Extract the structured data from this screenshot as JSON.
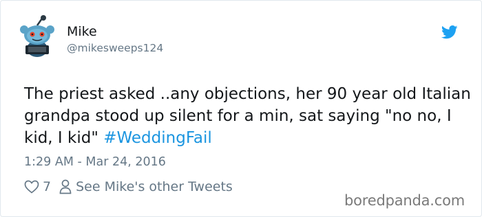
{
  "tweet": {
    "author_name": "Mike",
    "author_handle": "@mikesweeps124",
    "text": "The priest asked ..any objections, her 90 year old Italian grandpa stood up silent for a min, sat saying \"no no, I kid, I kid\" ",
    "hashtag": "#WeddingFail",
    "timestamp": "1:29 AM - Mar 24, 2016",
    "like_count": "7",
    "see_more_label": "See Mike's other Tweets"
  },
  "watermark": "boredpanda.com",
  "colors": {
    "twitter_blue": "#1da1f2",
    "hashtag": "#1b95e0",
    "secondary_text": "#657786"
  },
  "icons": {
    "avatar": "reddit-alien-avatar",
    "brand": "twitter-bird-icon",
    "like": "heart-outline-icon",
    "profile": "person-outline-icon"
  }
}
